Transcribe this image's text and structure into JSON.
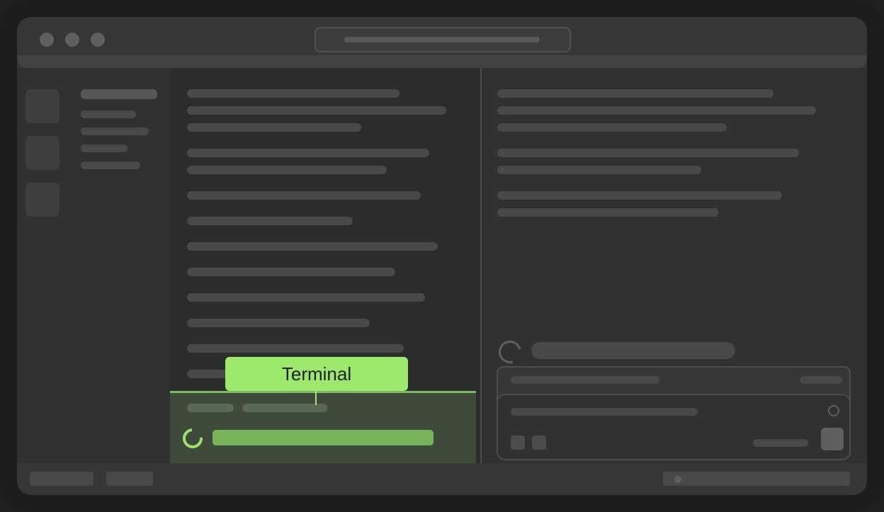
{
  "terminal_panel": {
    "label": "Terminal"
  }
}
